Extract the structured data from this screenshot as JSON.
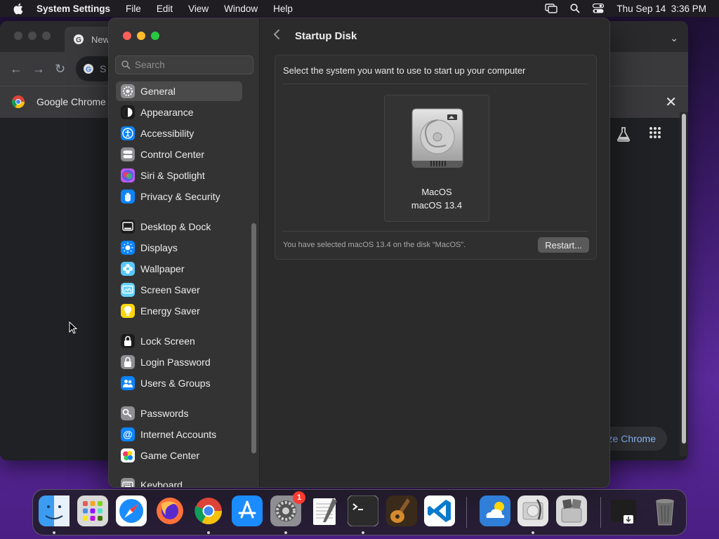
{
  "menubar": {
    "app_name": "System Settings",
    "menus": [
      "File",
      "Edit",
      "View",
      "Window",
      "Help"
    ],
    "clock": "Thu Sep 14  3:36 PM"
  },
  "chrome": {
    "tab_title": "New",
    "omnibox_text": "S",
    "infobar_label": "Google Chrome i",
    "customize_label": "ze Chrome"
  },
  "settings": {
    "search_placeholder": "Search",
    "sidebar_items": [
      {
        "label": "General",
        "icon": "gear-icon",
        "color": "#8e8e93",
        "selected": true
      },
      {
        "label": "Appearance",
        "icon": "appearance-icon",
        "color": "#1c1c1e"
      },
      {
        "label": "Accessibility",
        "icon": "accessibility-icon",
        "color": "#0a84ff"
      },
      {
        "label": "Control Center",
        "icon": "control-center-icon",
        "color": "#8e8e93"
      },
      {
        "label": "Siri & Spotlight",
        "icon": "siri-icon",
        "color": "#bf5af2"
      },
      {
        "label": "Privacy & Security",
        "icon": "hand-icon",
        "color": "#0a84ff"
      },
      {
        "label": "Desktop & Dock",
        "icon": "dock-icon",
        "color": "#1c1c1e"
      },
      {
        "label": "Displays",
        "icon": "sun-icon",
        "color": "#0a84ff"
      },
      {
        "label": "Wallpaper",
        "icon": "flower-icon",
        "color": "#5ac8fa"
      },
      {
        "label": "Screen Saver",
        "icon": "screen-saver-icon",
        "color": "#64d2ff"
      },
      {
        "label": "Energy Saver",
        "icon": "bulb-icon",
        "color": "#ffd60a"
      },
      {
        "label": "Lock Screen",
        "icon": "lock-icon",
        "color": "#1c1c1e"
      },
      {
        "label": "Login Password",
        "icon": "padlock-icon",
        "color": "#8e8e93"
      },
      {
        "label": "Users & Groups",
        "icon": "users-icon",
        "color": "#0a84ff"
      },
      {
        "label": "Passwords",
        "icon": "key-icon",
        "color": "#8e8e93"
      },
      {
        "label": "Internet Accounts",
        "icon": "at-icon",
        "color": "#0a84ff"
      },
      {
        "label": "Game Center",
        "icon": "game-center-icon",
        "color": "#ffffff"
      },
      {
        "label": "Keyboard",
        "icon": "keyboard-icon",
        "color": "#8e8e93"
      }
    ],
    "page_title": "Startup Disk",
    "prompt": "Select the system you want to use to start up your computer",
    "disk": {
      "name": "MacOS",
      "version": "macOS 13.4"
    },
    "status": "You have selected macOS 13.4 on the disk “MacOS”.",
    "restart_label": "Restart..."
  },
  "dock": {
    "apps": [
      {
        "name": "Finder",
        "icon": "finder-icon",
        "running": true
      },
      {
        "name": "Launchpad",
        "icon": "launchpad-icon",
        "running": false
      },
      {
        "name": "Safari",
        "icon": "safari-icon",
        "running": false
      },
      {
        "name": "Firefox",
        "icon": "firefox-icon",
        "running": false
      },
      {
        "name": "Chrome",
        "icon": "chrome-icon",
        "running": true
      },
      {
        "name": "App Store",
        "icon": "app-store-icon",
        "running": false
      },
      {
        "name": "System Settings",
        "icon": "system-settings-icon",
        "running": true,
        "badge": "1"
      },
      {
        "name": "TextEdit",
        "icon": "textedit-icon",
        "running": false
      },
      {
        "name": "Terminal",
        "icon": "terminal-icon",
        "running": true
      },
      {
        "name": "GarageBand",
        "icon": "garageband-icon",
        "running": false
      },
      {
        "name": "VS Code",
        "icon": "vscode-icon",
        "running": false
      },
      {
        "name": "Weather",
        "icon": "weather-icon",
        "running": false
      },
      {
        "name": "Disk Utility",
        "icon": "disk-utility-icon",
        "running": true
      },
      {
        "name": "Boot Camp",
        "icon": "boot-camp-icon",
        "running": false
      },
      {
        "name": "Downloads",
        "icon": "downloads-icon",
        "running": false
      },
      {
        "name": "Trash",
        "icon": "trash-icon",
        "running": false
      }
    ]
  }
}
